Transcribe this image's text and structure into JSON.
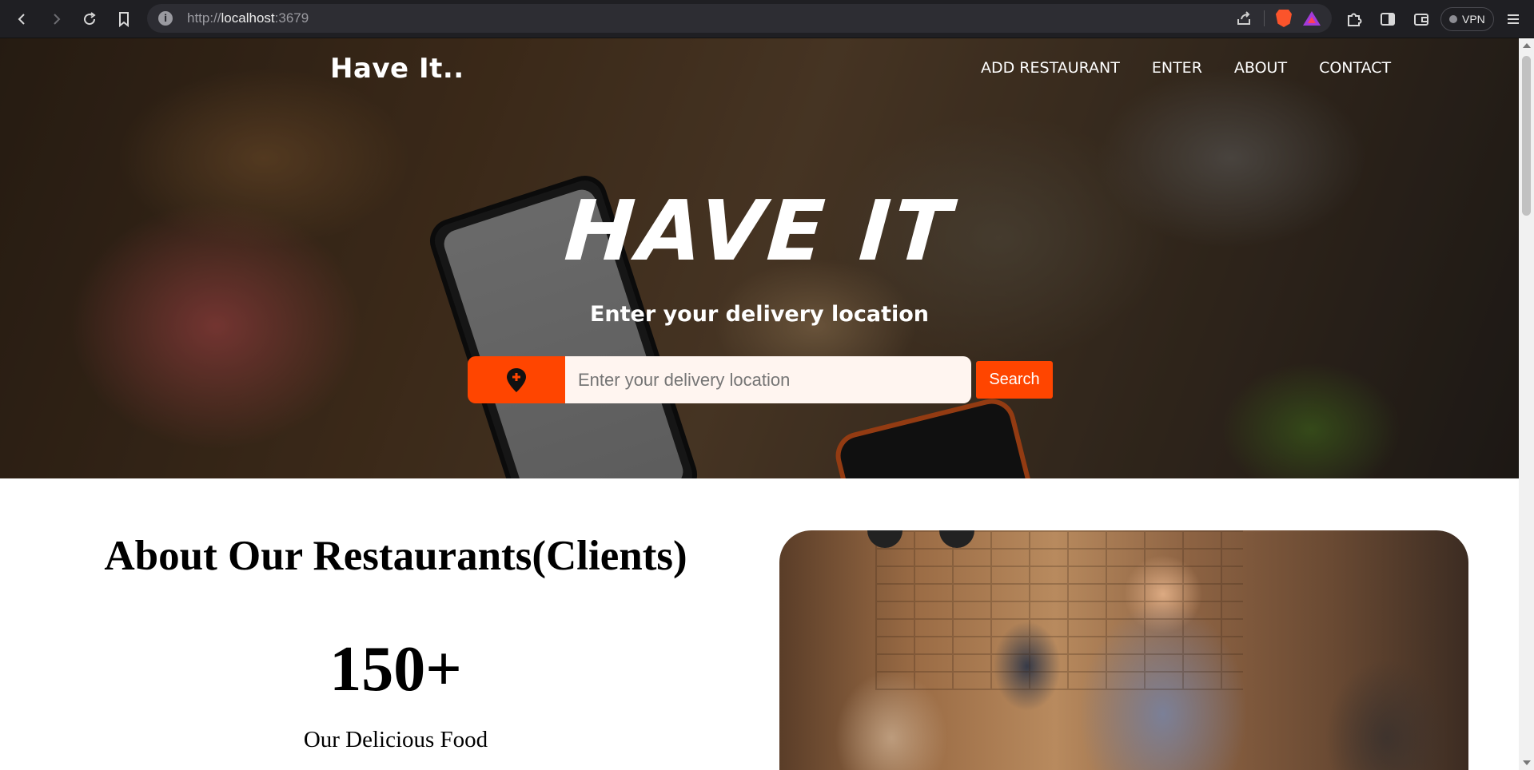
{
  "browser": {
    "url_prefix": "http://",
    "url_host": "localhost",
    "url_port": ":3679",
    "vpn_label": "VPN"
  },
  "nav": {
    "logo": "Have It..",
    "links": [
      "ADD RESTAURANT",
      "ENTER",
      "ABOUT",
      "CONTACT"
    ]
  },
  "hero": {
    "title": "HAVE IT",
    "subtitle": "Enter your delivery location",
    "input_placeholder": "Enter your delivery location",
    "search_label": "Search"
  },
  "about": {
    "title": "About Our Restaurants(Clients)",
    "stat_number": "150+",
    "stat_label": "Our Delicious Food"
  },
  "colors": {
    "accent": "#ff4500",
    "chrome_bg": "#1f1f23"
  }
}
